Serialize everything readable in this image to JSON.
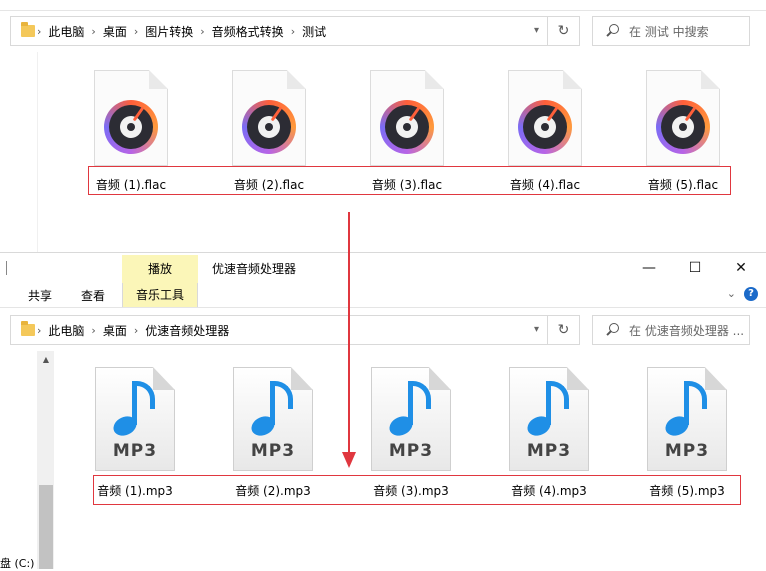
{
  "top_window": {
    "breadcrumbs": [
      "此电脑",
      "桌面",
      "图片转换",
      "音频格式转换",
      "测试"
    ],
    "search_placeholder": "在 测试 中搜索",
    "files": [
      {
        "name": "音频 (1).flac"
      },
      {
        "name": "音频 (2).flac"
      },
      {
        "name": "音频 (3).flac"
      },
      {
        "name": "音频 (4).flac"
      },
      {
        "name": "音频 (5).flac"
      }
    ],
    "file_icon": "flac-disc-icon"
  },
  "bottom_window": {
    "title": "优速音频处理器",
    "contextual_tab": "播放",
    "ribbon_tabs": {
      "share": "共享",
      "view": "查看",
      "music_tools": "音乐工具"
    },
    "window_buttons": {
      "minimize": "—",
      "maximize": "☐",
      "close": "✕"
    },
    "breadcrumbs": [
      "此电脑",
      "桌面",
      "优速音频处理器"
    ],
    "search_placeholder": "在 优速音频处理器 ...",
    "files": [
      {
        "name": "音频 (1).mp3"
      },
      {
        "name": "音频 (2).mp3"
      },
      {
        "name": "音频 (3).mp3"
      },
      {
        "name": "音频 (4).mp3"
      },
      {
        "name": "音频 (5).mp3"
      }
    ],
    "mp3_label": "MP3",
    "nav_drive_label": "盘 (C:)"
  },
  "colors": {
    "highlight_box": "#e0373f",
    "contextual_tab": "#fbf6b8",
    "note_blue": "#1f8fe6"
  }
}
